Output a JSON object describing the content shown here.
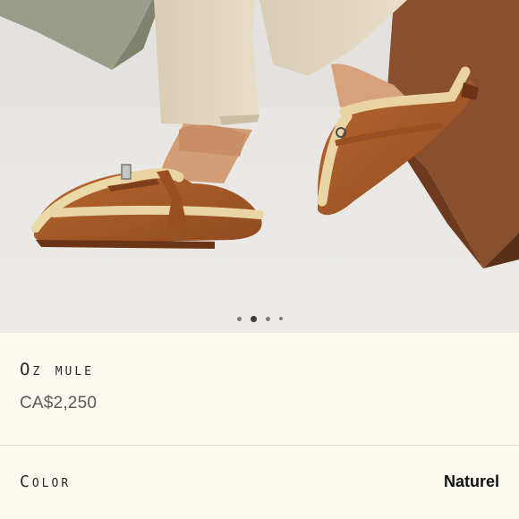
{
  "product": {
    "name": "Oz mule",
    "price": "CA$2,250"
  },
  "gallery": {
    "image": "shearling-suede-mules-photo",
    "slide_count": 4,
    "active_slide": 2
  },
  "color": {
    "label": "Color",
    "value": "Naturel"
  }
}
